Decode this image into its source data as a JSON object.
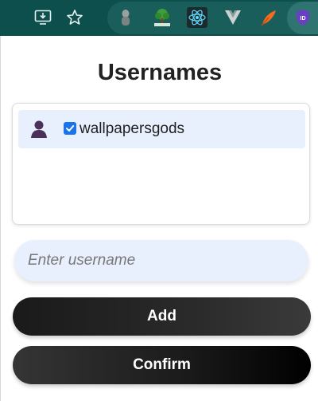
{
  "browser_toolbar": {
    "icons": [
      "install-app-icon",
      "bookmark-star-icon",
      "puppet-extension-icon",
      "tree-extension-icon",
      "react-extension-icon",
      "vue-extension-icon",
      "feather-extension-icon",
      "shield-extension-icon"
    ]
  },
  "popup": {
    "title": "Usernames",
    "usernames": [
      {
        "name": "wallpapersgods",
        "checked": true
      }
    ],
    "input": {
      "placeholder": "Enter username",
      "value": ""
    },
    "add_label": "Add",
    "confirm_label": "Confirm"
  },
  "colors": {
    "toolbar_bg": "#0d4f4d",
    "item_bg": "#e8f0fe",
    "checkbox": "#1a73e8",
    "button_dark": "#1a1a1a"
  }
}
